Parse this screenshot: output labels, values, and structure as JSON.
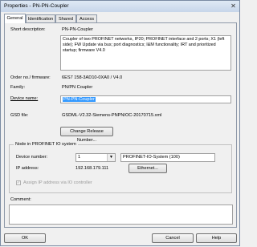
{
  "window": {
    "title": "Properties - PN-PN-Coupler",
    "close_glyph": "✕"
  },
  "tabs": [
    {
      "label": "General"
    },
    {
      "label": "Identification"
    },
    {
      "label": "Shared"
    },
    {
      "label": "Access"
    }
  ],
  "general": {
    "short_description_label": "Short description:",
    "short_description_title": "PN-PN-Coupler",
    "short_description_text": "Coupler of two PROFINET networks, IP20; PROFINET interface and 2 ports; X1 (left side); FW Update via bus; port diagnostics; I&M functionality; IRT and prioritized startup; firmware V4.0",
    "order_label": "Order no./ firmware:",
    "order_value": "6ES7 158-3AD10-0XA0 / V4.0",
    "family_label": "Family:",
    "family_value": "PN/PN Coupler",
    "device_name_label": "Device name:",
    "device_name_value": "PN-PN-Coupler",
    "gsd_label": "GSD file:",
    "gsd_value": "GSDML-V2.32-Siemens-PNPNIOC-20170715.xml",
    "change_release_button": "Change Release Number..."
  },
  "node": {
    "group_title": "Node in PROFINET IO system",
    "device_number_label": "Device number:",
    "device_number_value": "1",
    "io_system_value": "PROFINET-IO-System (100)",
    "ip_label": "IP address:",
    "ip_value": "192.168.179.111",
    "ethernet_button": "Ethernet...",
    "assign_ip_label": "Assign IP address via IO controller",
    "assign_ip_checked": true
  },
  "comment": {
    "label": "Comment:",
    "value": ""
  },
  "footer": {
    "ok": "OK",
    "cancel": "Cancel",
    "help": "Help"
  }
}
